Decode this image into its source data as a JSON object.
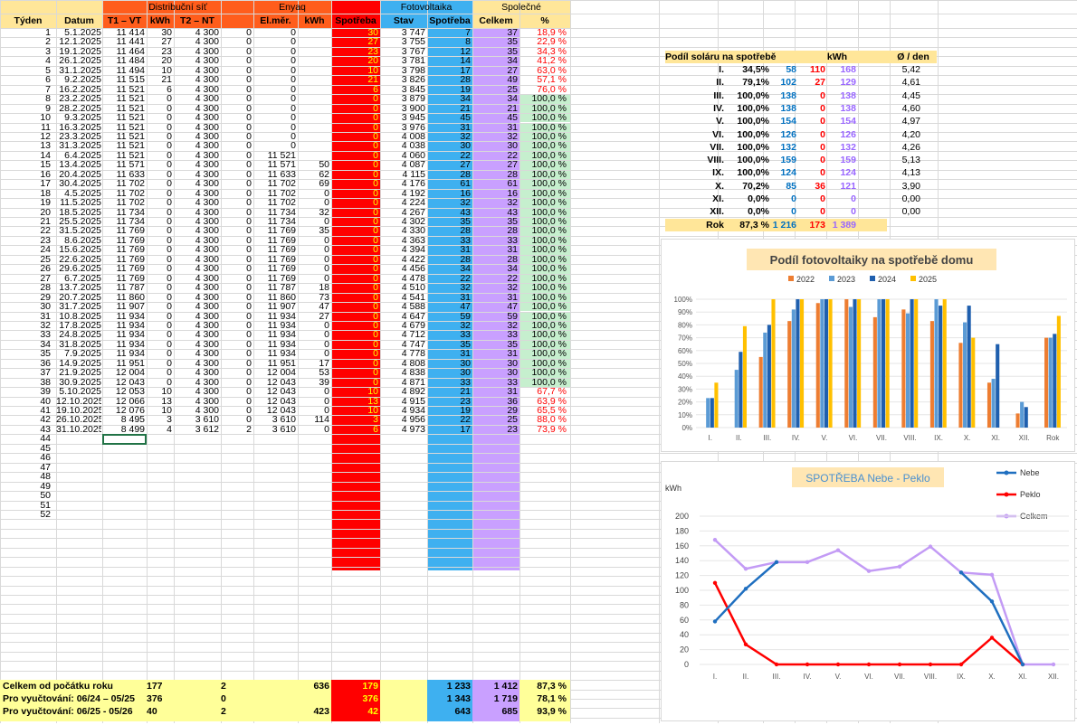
{
  "colors": {
    "distrib": "#ff5d1c",
    "enyaq": "#ff5d1c",
    "spotreba": "#ff0000",
    "fve": "#3eb0f0",
    "spolecne": "#c9a0ff",
    "header": "#ffe699",
    "green": "#c6efce",
    "footer": "#ffff99",
    "red": "#ff0000",
    "blue": "#0070c0",
    "purple": "#9966ff"
  },
  "header": {
    "groups": {
      "distrib": "Distribuční síť",
      "enyaq": "Enyaq",
      "fve": "Fotovoltaika",
      "spolecne": "Společné"
    },
    "cols": {
      "tyden": "Týden",
      "datum": "Datum",
      "t1": "T1 – VT",
      "kwh1": "kWh",
      "t2": "T2 – NT",
      "elmer": "El.měr.",
      "kwh2": "kWh",
      "spotreba": "Spotřeba",
      "stav": "Stav",
      "fspot": "Spotřeba",
      "celkem": "Celkem",
      "pct": "%"
    }
  },
  "rows": [
    [
      "1",
      "5.1.2025",
      "11 414",
      "30",
      "4 300",
      "0",
      "0",
      "",
      "30",
      "3 747",
      "7",
      "37",
      "18,9 %"
    ],
    [
      "2",
      "12.1.2025",
      "11 441",
      "27",
      "4 300",
      "0",
      "0",
      "",
      "27",
      "3 755",
      "8",
      "35",
      "22,9 %"
    ],
    [
      "3",
      "19.1.2025",
      "11 464",
      "23",
      "4 300",
      "0",
      "0",
      "",
      "23",
      "3 767",
      "12",
      "35",
      "34,3 %"
    ],
    [
      "4",
      "26.1.2025",
      "11 484",
      "20",
      "4 300",
      "0",
      "0",
      "",
      "20",
      "3 781",
      "14",
      "34",
      "41,2 %"
    ],
    [
      "5",
      "31.1.2025",
      "11 494",
      "10",
      "4 300",
      "0",
      "0",
      "",
      "10",
      "3 798",
      "17",
      "27",
      "63,0 %"
    ],
    [
      "6",
      "9.2.2025",
      "11 515",
      "21",
      "4 300",
      "0",
      "0",
      "",
      "21",
      "3 826",
      "28",
      "49",
      "57,1 %"
    ],
    [
      "7",
      "16.2.2025",
      "11 521",
      "6",
      "4 300",
      "0",
      "0",
      "",
      "6",
      "3 845",
      "19",
      "25",
      "76,0 %"
    ],
    [
      "8",
      "23.2.2025",
      "11 521",
      "0",
      "4 300",
      "0",
      "0",
      "",
      "0",
      "3 879",
      "34",
      "34",
      "100,0 %"
    ],
    [
      "9",
      "28.2.2025",
      "11 521",
      "0",
      "4 300",
      "0",
      "0",
      "",
      "0",
      "3 900",
      "21",
      "21",
      "100,0 %"
    ],
    [
      "10",
      "9.3.2025",
      "11 521",
      "0",
      "4 300",
      "0",
      "0",
      "",
      "0",
      "3 945",
      "45",
      "45",
      "100,0 %"
    ],
    [
      "11",
      "16.3.2025",
      "11 521",
      "0",
      "4 300",
      "0",
      "0",
      "",
      "0",
      "3 976",
      "31",
      "31",
      "100,0 %"
    ],
    [
      "12",
      "23.3.2025",
      "11 521",
      "0",
      "4 300",
      "0",
      "0",
      "",
      "0",
      "4 008",
      "32",
      "32",
      "100,0 %"
    ],
    [
      "13",
      "31.3.2025",
      "11 521",
      "0",
      "4 300",
      "0",
      "0",
      "",
      "0",
      "4 038",
      "30",
      "30",
      "100,0 %"
    ],
    [
      "14",
      "6.4.2025",
      "11 521",
      "0",
      "4 300",
      "0",
      "11 521",
      "",
      "0",
      "4 060",
      "22",
      "22",
      "100,0 %"
    ],
    [
      "15",
      "13.4.2025",
      "11 571",
      "0",
      "4 300",
      "0",
      "11 571",
      "50",
      "0",
      "4 087",
      "27",
      "27",
      "100,0 %"
    ],
    [
      "16",
      "20.4.2025",
      "11 633",
      "0",
      "4 300",
      "0",
      "11 633",
      "62",
      "0",
      "4 115",
      "28",
      "28",
      "100,0 %"
    ],
    [
      "17",
      "30.4.2025",
      "11 702",
      "0",
      "4 300",
      "0",
      "11 702",
      "69",
      "0",
      "4 176",
      "61",
      "61",
      "100,0 %"
    ],
    [
      "18",
      "4.5.2025",
      "11 702",
      "0",
      "4 300",
      "0",
      "11 702",
      "0",
      "0",
      "4 192",
      "16",
      "16",
      "100,0 %"
    ],
    [
      "19",
      "11.5.2025",
      "11 702",
      "0",
      "4 300",
      "0",
      "11 702",
      "0",
      "0",
      "4 224",
      "32",
      "32",
      "100,0 %"
    ],
    [
      "20",
      "18.5.2025",
      "11 734",
      "0",
      "4 300",
      "0",
      "11 734",
      "32",
      "0",
      "4 267",
      "43",
      "43",
      "100,0 %"
    ],
    [
      "21",
      "25.5.2025",
      "11 734",
      "0",
      "4 300",
      "0",
      "11 734",
      "0",
      "0",
      "4 302",
      "35",
      "35",
      "100,0 %"
    ],
    [
      "22",
      "31.5.2025",
      "11 769",
      "0",
      "4 300",
      "0",
      "11 769",
      "35",
      "0",
      "4 330",
      "28",
      "28",
      "100,0 %"
    ],
    [
      "23",
      "8.6.2025",
      "11 769",
      "0",
      "4 300",
      "0",
      "11 769",
      "0",
      "0",
      "4 363",
      "33",
      "33",
      "100,0 %"
    ],
    [
      "24",
      "15.6.2025",
      "11 769",
      "0",
      "4 300",
      "0",
      "11 769",
      "0",
      "0",
      "4 394",
      "31",
      "31",
      "100,0 %"
    ],
    [
      "25",
      "22.6.2025",
      "11 769",
      "0",
      "4 300",
      "0",
      "11 769",
      "0",
      "0",
      "4 422",
      "28",
      "28",
      "100,0 %"
    ],
    [
      "26",
      "29.6.2025",
      "11 769",
      "0",
      "4 300",
      "0",
      "11 769",
      "0",
      "0",
      "4 456",
      "34",
      "34",
      "100,0 %"
    ],
    [
      "27",
      "6.7.2025",
      "11 769",
      "0",
      "4 300",
      "0",
      "11 769",
      "0",
      "0",
      "4 478",
      "22",
      "22",
      "100,0 %"
    ],
    [
      "28",
      "13.7.2025",
      "11 787",
      "0",
      "4 300",
      "0",
      "11 787",
      "18",
      "0",
      "4 510",
      "32",
      "32",
      "100,0 %"
    ],
    [
      "29",
      "20.7.2025",
      "11 860",
      "0",
      "4 300",
      "0",
      "11 860",
      "73",
      "0",
      "4 541",
      "31",
      "31",
      "100,0 %"
    ],
    [
      "30",
      "31.7.2025",
      "11 907",
      "0",
      "4 300",
      "0",
      "11 907",
      "47",
      "0",
      "4 588",
      "47",
      "47",
      "100,0 %"
    ],
    [
      "31",
      "10.8.2025",
      "11 934",
      "0",
      "4 300",
      "0",
      "11 934",
      "27",
      "0",
      "4 647",
      "59",
      "59",
      "100,0 %"
    ],
    [
      "32",
      "17.8.2025",
      "11 934",
      "0",
      "4 300",
      "0",
      "11 934",
      "0",
      "0",
      "4 679",
      "32",
      "32",
      "100,0 %"
    ],
    [
      "33",
      "24.8.2025",
      "11 934",
      "0",
      "4 300",
      "0",
      "11 934",
      "0",
      "0",
      "4 712",
      "33",
      "33",
      "100,0 %"
    ],
    [
      "34",
      "31.8.2025",
      "11 934",
      "0",
      "4 300",
      "0",
      "11 934",
      "0",
      "0",
      "4 747",
      "35",
      "35",
      "100,0 %"
    ],
    [
      "35",
      "7.9.2025",
      "11 934",
      "0",
      "4 300",
      "0",
      "11 934",
      "0",
      "0",
      "4 778",
      "31",
      "31",
      "100,0 %"
    ],
    [
      "36",
      "14.9.2025",
      "11 951",
      "0",
      "4 300",
      "0",
      "11 951",
      "17",
      "0",
      "4 808",
      "30",
      "30",
      "100,0 %"
    ],
    [
      "37",
      "21.9.2025",
      "12 004",
      "0",
      "4 300",
      "0",
      "12 004",
      "53",
      "0",
      "4 838",
      "30",
      "30",
      "100,0 %"
    ],
    [
      "38",
      "30.9.2025",
      "12 043",
      "0",
      "4 300",
      "0",
      "12 043",
      "39",
      "0",
      "4 871",
      "33",
      "33",
      "100,0 %"
    ],
    [
      "39",
      "5.10.2025",
      "12 053",
      "10",
      "4 300",
      "0",
      "12 043",
      "0",
      "10",
      "4 892",
      "21",
      "31",
      "67,7 %"
    ],
    [
      "40",
      "12.10.2025",
      "12 066",
      "13",
      "4 300",
      "0",
      "12 043",
      "0",
      "13",
      "4 915",
      "23",
      "36",
      "63,9 %"
    ],
    [
      "41",
      "19.10.2025",
      "12 076",
      "10",
      "4 300",
      "0",
      "12 043",
      "0",
      "10",
      "4 934",
      "19",
      "29",
      "65,5 %"
    ],
    [
      "42",
      "26.10.2025",
      "8 495",
      "3",
      "3 610",
      "0",
      "3 610",
      "114",
      "3",
      "4 956",
      "22",
      "25",
      "88,0 %"
    ],
    [
      "43",
      "31.10.2025",
      "8 499",
      "4",
      "3 612",
      "2",
      "3 610",
      "0",
      "6",
      "4 973",
      "17",
      "23",
      "73,9 %"
    ]
  ],
  "empty_rows": [
    "44",
    "45",
    "46",
    "47",
    "48",
    "49",
    "50",
    "51",
    "52"
  ],
  "footer": [
    {
      "label": "Celkem od počátku roku",
      "kwh1": "177",
      "t2": "",
      "nt": "2",
      "kwh2": "636",
      "spot": "179",
      "fspot": "1 233",
      "celkem": "1 412",
      "pct": "87,3 %"
    },
    {
      "label": "Pro vyučtování: 06/24 – 05/25",
      "kwh1": "376",
      "t2": "",
      "nt": "0",
      "kwh2": "",
      "spot": "376",
      "fspot": "1 343",
      "celkem": "1 719",
      "pct": "78,1 %"
    },
    {
      "label": "Pro vyučtování: 06/25 - 05/26",
      "kwh1": "40",
      "t2": "",
      "nt": "2",
      "kwh2": "423",
      "spot": "42",
      "fspot": "643",
      "celkem": "685",
      "pct": "93,9 %"
    }
  ],
  "solar_table": {
    "title": "Podíl soláru na spotřebě",
    "kwh": "kWh",
    "perday": "Ø  / den",
    "rows": [
      [
        "I.",
        "34,5%",
        "58",
        "110",
        "168",
        "5,42"
      ],
      [
        "II.",
        "79,1%",
        "102",
        "27",
        "129",
        "4,61"
      ],
      [
        "III.",
        "100,0%",
        "138",
        "0",
        "138",
        "4,45"
      ],
      [
        "IV.",
        "100,0%",
        "138",
        "0",
        "138",
        "4,60"
      ],
      [
        "V.",
        "100,0%",
        "154",
        "0",
        "154",
        "4,97"
      ],
      [
        "VI.",
        "100,0%",
        "126",
        "0",
        "126",
        "4,20"
      ],
      [
        "VII.",
        "100,0%",
        "132",
        "0",
        "132",
        "4,26"
      ],
      [
        "VIII.",
        "100,0%",
        "159",
        "0",
        "159",
        "5,13"
      ],
      [
        "IX.",
        "100,0%",
        "124",
        "0",
        "124",
        "4,13"
      ],
      [
        "X.",
        "70,2%",
        "85",
        "36",
        "121",
        "3,90"
      ],
      [
        "XI.",
        "0,0%",
        "0",
        "0",
        "0",
        "0,00"
      ],
      [
        "XII.",
        "0,0%",
        "0",
        "0",
        "0",
        "0,00"
      ]
    ],
    "total": [
      "Rok",
      "87,3 %",
      "1 216",
      "173",
      "1 389"
    ]
  },
  "chart_data": [
    {
      "type": "bar",
      "title": "Podíl fotovoltaiky na spotřebě domu",
      "categories": [
        "I.",
        "II.",
        "III.",
        "IV.",
        "V.",
        "VI.",
        "VII.",
        "VIII.",
        "IX.",
        "X.",
        "XI.",
        "XII.",
        "Rok"
      ],
      "yticks": [
        "0%",
        "10%",
        "20%",
        "30%",
        "40%",
        "50%",
        "60%",
        "70%",
        "80%",
        "90%",
        "100%"
      ],
      "ylim": [
        0,
        100
      ],
      "legend": "top",
      "series": [
        {
          "name": "2022",
          "color": "#ed7d31",
          "values": [
            0,
            0,
            55,
            83,
            97,
            100,
            86,
            92,
            83,
            66,
            35,
            11,
            70
          ]
        },
        {
          "name": "2023",
          "color": "#5b9bd5",
          "values": [
            23,
            45,
            74,
            92,
            100,
            94,
            100,
            89,
            100,
            82,
            38,
            20,
            70
          ]
        },
        {
          "name": "2024",
          "color": "#1f5fae",
          "values": [
            23,
            59,
            80,
            100,
            100,
            100,
            100,
            100,
            95,
            95,
            65,
            16,
            73
          ]
        },
        {
          "name": "2025",
          "color": "#ffc000",
          "values": [
            35,
            79,
            100,
            100,
            100,
            100,
            100,
            100,
            100,
            70,
            0,
            0,
            87
          ]
        }
      ]
    },
    {
      "type": "line",
      "title": "SPOTŘEBA  Nebe - Peklo",
      "ylabel": "kWh",
      "categories": [
        "I.",
        "II.",
        "III.",
        "IV.",
        "V.",
        "VI.",
        "VII.",
        "VIII.",
        "IX.",
        "X.",
        "XI.",
        "XII."
      ],
      "yticks": [
        "0",
        "20",
        "40",
        "60",
        "80",
        "100",
        "120",
        "140",
        "160",
        "180",
        "200"
      ],
      "ylim": [
        0,
        200
      ],
      "legend": "top-right",
      "series": [
        {
          "name": "Nebe",
          "color": "#1f6fc0",
          "values": [
            58,
            102,
            138,
            null,
            null,
            null,
            null,
            null,
            124,
            85,
            0,
            null
          ]
        },
        {
          "name": "Peklo",
          "color": "#ff0000",
          "values": [
            110,
            27,
            0,
            0,
            0,
            0,
            0,
            0,
            0,
            36,
            0,
            null
          ]
        },
        {
          "name": "Celkem",
          "color": "#c39bf5",
          "values": [
            168,
            129,
            138,
            138,
            154,
            126,
            132,
            159,
            124,
            121,
            0,
            0
          ]
        }
      ]
    }
  ]
}
